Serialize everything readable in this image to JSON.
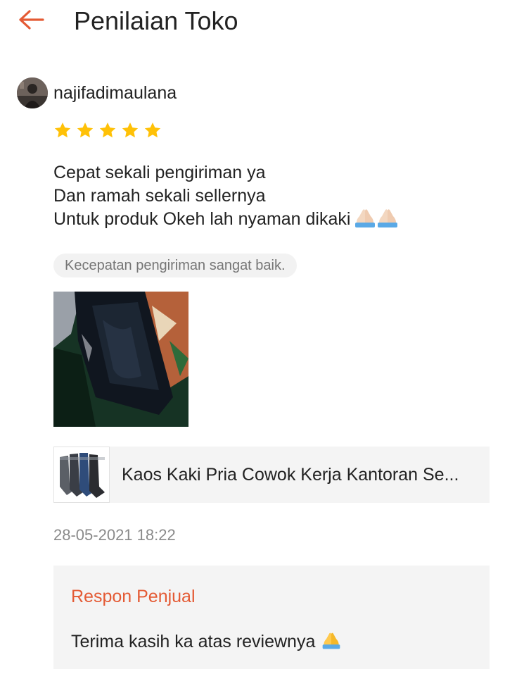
{
  "header": {
    "title": "Penilaian Toko",
    "back_icon": "arrow-left-icon",
    "accent_color": "#e45a34"
  },
  "review": {
    "username": "najifadimaulana",
    "rating": 5,
    "rating_max": 5,
    "star_color": "#ffc107",
    "text_lines": [
      "Cepat sekali pengiriman ya",
      "Dan ramah sekali sellernya",
      "Untuk produk Okeh lah nyaman dikaki"
    ],
    "tag": "Kecepatan pengiriman sangat baik.",
    "photo_icon": "review-photo",
    "product": {
      "name": "Kaos Kaki Pria Cowok Kerja Kantoran Se..."
    },
    "timestamp": "28-05-2021 18:22",
    "seller_response": {
      "title": "Respon Penjual",
      "text": "Terima kasih ka atas reviewnya"
    }
  }
}
